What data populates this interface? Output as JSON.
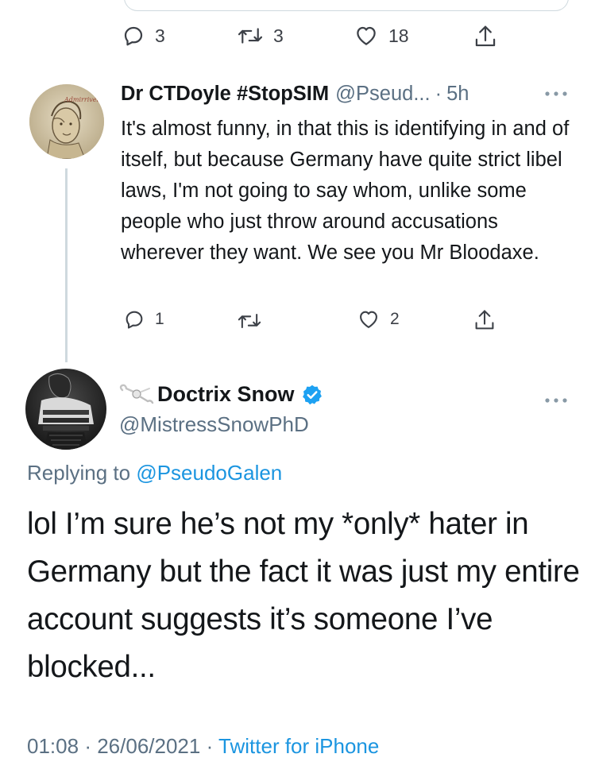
{
  "previous_tweet": {
    "actions": {
      "reply_count": "3",
      "retweet_count": "3",
      "like_count": "18"
    }
  },
  "reply": {
    "name": "Dr CTDoyle #StopSIM",
    "handle": "@Pseud...",
    "separator": "·",
    "time": "5h",
    "text": "It's almost funny, in that this is identifying in and of itself, but because Germany have quite strict libel laws, I'm not going to say whom, unlike some people who just throw around accusations wherever they want. We see you Mr Bloodaxe.",
    "avatar_caption": "Admirrivelle",
    "actions": {
      "reply_count": "1",
      "retweet_count": "",
      "like_count": "2"
    }
  },
  "main_tweet": {
    "name": "Doctrix Snow",
    "handle": "@MistressSnowPhD",
    "replying_prefix": "Replying to",
    "replying_to": "@PseudoGalen",
    "text": "lol I’m sure he’s not my *only* hater in Germany but the fact it was just my entire account suggests it’s someone I’ve blocked...",
    "time": "01:08",
    "separator": "·",
    "date": "26/06/2021",
    "source": "Twitter for iPhone"
  },
  "icons": {
    "reply": "reply-icon",
    "retweet": "retweet-icon",
    "like": "heart-icon",
    "share": "share-icon",
    "more": "more-icon",
    "verified": "verified-badge-icon",
    "name_prefix": "bone-emoji-icon"
  },
  "colors": {
    "link": "#1b95e0",
    "secondary_text": "#5b7083",
    "verified": "#1da1f2",
    "divider": "#cfd9de"
  }
}
